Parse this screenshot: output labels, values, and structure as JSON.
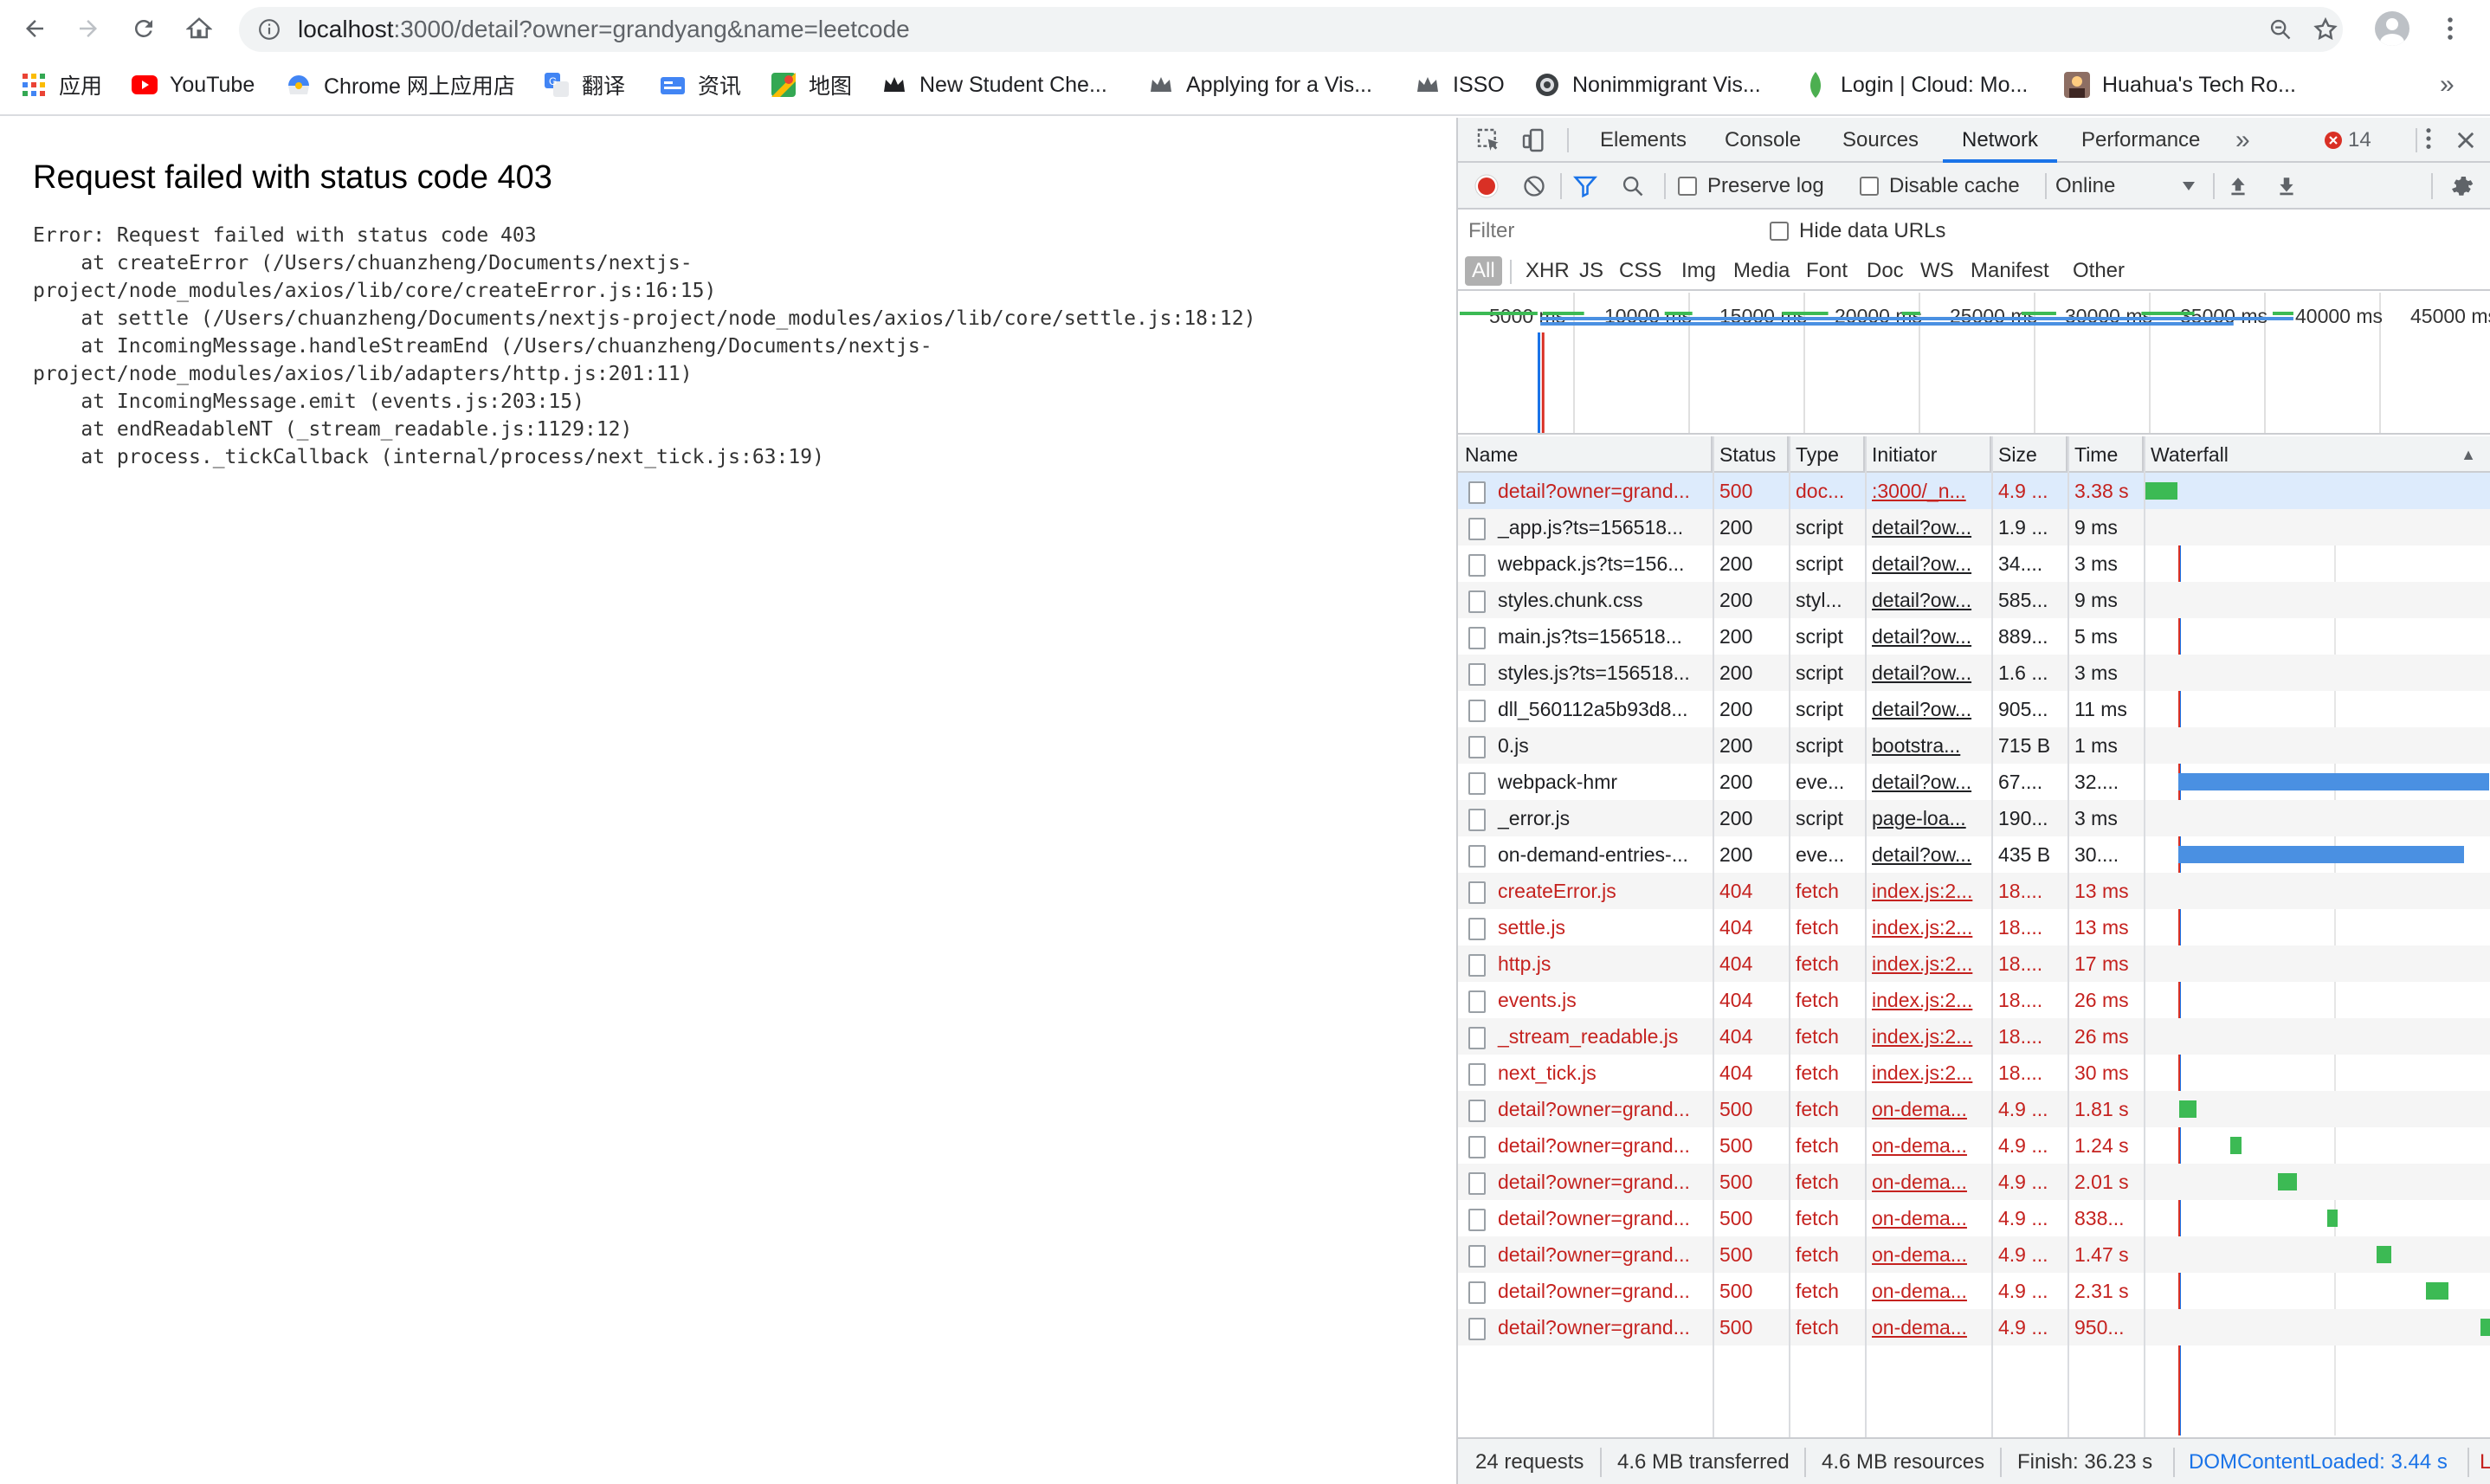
{
  "browser": {
    "url_host": "localhost",
    "url_rest": ":3000/detail?owner=grandyang&name=leetcode"
  },
  "bookmarks": [
    {
      "label": "应用",
      "icon": "apps-grid-icon"
    },
    {
      "label": "YouTube",
      "icon": "youtube-icon"
    },
    {
      "label": "Chrome 网上应用店",
      "icon": "chrome-webstore-icon"
    },
    {
      "label": "翻译",
      "icon": "translate-icon"
    },
    {
      "label": "资讯",
      "icon": "news-icon"
    },
    {
      "label": "地图",
      "icon": "maps-icon"
    },
    {
      "label": "New Student Che...",
      "icon": "crown-icon"
    },
    {
      "label": "Applying for a Vis...",
      "icon": "crown-icon"
    },
    {
      "label": "ISSO",
      "icon": "crown-icon"
    },
    {
      "label": "Nonimmigrant Vis...",
      "icon": "seal-icon"
    },
    {
      "label": "Login | Cloud: Mo...",
      "icon": "leaf-icon"
    },
    {
      "label": "Huahua's Tech Ro...",
      "icon": "avatar-icon"
    }
  ],
  "page": {
    "title": "Request failed with status code 403",
    "stack": "Error: Request failed with status code 403\n    at createError (/Users/chuanzheng/Documents/nextjs-\nproject/node_modules/axios/lib/core/createError.js:16:15)\n    at settle (/Users/chuanzheng/Documents/nextjs-project/node_modules/axios/lib/core/settle.js:18:12)\n    at IncomingMessage.handleStreamEnd (/Users/chuanzheng/Documents/nextjs-\nproject/node_modules/axios/lib/adapters/http.js:201:11)\n    at IncomingMessage.emit (events.js:203:15)\n    at endReadableNT (_stream_readable.js:1129:12)\n    at process._tickCallback (internal/process/next_tick.js:63:19)"
  },
  "devtools": {
    "tabs": [
      "Elements",
      "Console",
      "Sources",
      "Network",
      "Performance"
    ],
    "active_tab": "Network",
    "more_tabs": "»",
    "error_count": "14",
    "toolbar": {
      "preserve_log": "Preserve log",
      "disable_cache": "Disable cache",
      "throttle": "Online"
    },
    "filter_placeholder": "Filter",
    "hide_data_urls": "Hide data URLs",
    "types": [
      "All",
      "XHR",
      "JS",
      "CSS",
      "Img",
      "Media",
      "Font",
      "Doc",
      "WS",
      "Manifest",
      "Other"
    ],
    "overview_ticks": [
      "5000 ms",
      "10000 ms",
      "15000 ms",
      "20000 ms",
      "25000 ms",
      "30000 ms",
      "35000 ms",
      "40000 ms",
      "45000 ms"
    ],
    "columns": [
      "Name",
      "Status",
      "Type",
      "Initiator",
      "Size",
      "Time",
      "Waterfall"
    ],
    "sort_indicator": "▲",
    "rows": [
      {
        "name": "detail?owner=grand...",
        "status": "500",
        "type": "doc...",
        "initiator": ":3000/_n...",
        "size": "4.9 ...",
        "time": "3.38 s",
        "error": true,
        "wf_start": 0.0,
        "wf_end": 3.38,
        "wf_color": "#3cba54"
      },
      {
        "name": "_app.js?ts=156518...",
        "status": "200",
        "type": "script",
        "initiator": "detail?ow...",
        "size": "1.9 ...",
        "time": "9 ms",
        "error": false
      },
      {
        "name": "webpack.js?ts=156...",
        "status": "200",
        "type": "script",
        "initiator": "detail?ow...",
        "size": "34....",
        "time": "3 ms",
        "error": false
      },
      {
        "name": "styles.chunk.css",
        "status": "200",
        "type": "styl...",
        "initiator": "detail?ow...",
        "size": "585...",
        "time": "9 ms",
        "error": false
      },
      {
        "name": "main.js?ts=156518...",
        "status": "200",
        "type": "script",
        "initiator": "detail?ow...",
        "size": "889...",
        "time": "5 ms",
        "error": false
      },
      {
        "name": "styles.js?ts=156518...",
        "status": "200",
        "type": "script",
        "initiator": "detail?ow...",
        "size": "1.6 ...",
        "time": "3 ms",
        "error": false
      },
      {
        "name": "dll_560112a5b93d8...",
        "status": "200",
        "type": "script",
        "initiator": "detail?ow...",
        "size": "905...",
        "time": "11 ms",
        "error": false
      },
      {
        "name": "0.js",
        "status": "200",
        "type": "script",
        "initiator": "bootstra...",
        "size": "715 B",
        "time": "1 ms",
        "error": false
      },
      {
        "name": "webpack-hmr",
        "status": "200",
        "type": "eve...",
        "initiator": "detail?ow...",
        "size": "67....",
        "time": "32....",
        "error": false,
        "wf_start": 3.5,
        "wf_end": 36.2,
        "wf_color": "#4a90e2"
      },
      {
        "name": "_error.js",
        "status": "200",
        "type": "script",
        "initiator": "page-loa...",
        "size": "190...",
        "time": "3 ms",
        "error": false
      },
      {
        "name": "on-demand-entries-...",
        "status": "200",
        "type": "eve...",
        "initiator": "detail?ow...",
        "size": "435 B",
        "time": "30....",
        "error": false,
        "wf_start": 3.5,
        "wf_end": 33.6,
        "wf_color": "#4a90e2"
      },
      {
        "name": "createError.js",
        "status": "404",
        "type": "fetch",
        "initiator": "index.js:2...",
        "size": "18....",
        "time": "13 ms",
        "error": true
      },
      {
        "name": "settle.js",
        "status": "404",
        "type": "fetch",
        "initiator": "index.js:2...",
        "size": "18....",
        "time": "13 ms",
        "error": true
      },
      {
        "name": "http.js",
        "status": "404",
        "type": "fetch",
        "initiator": "index.js:2...",
        "size": "18....",
        "time": "17 ms",
        "error": true
      },
      {
        "name": "events.js",
        "status": "404",
        "type": "fetch",
        "initiator": "index.js:2...",
        "size": "18....",
        "time": "26 ms",
        "error": true
      },
      {
        "name": "_stream_readable.js",
        "status": "404",
        "type": "fetch",
        "initiator": "index.js:2...",
        "size": "18....",
        "time": "26 ms",
        "error": true
      },
      {
        "name": "next_tick.js",
        "status": "404",
        "type": "fetch",
        "initiator": "index.js:2...",
        "size": "18....",
        "time": "30 ms",
        "error": true
      },
      {
        "name": "detail?owner=grand...",
        "status": "500",
        "type": "fetch",
        "initiator": "on-dema...",
        "size": "4.9 ...",
        "time": "1.81 s",
        "error": true,
        "wf_start": 3.6,
        "wf_end": 5.4,
        "wf_color": "#3cba54"
      },
      {
        "name": "detail?owner=grand...",
        "status": "500",
        "type": "fetch",
        "initiator": "on-dema...",
        "size": "4.9 ...",
        "time": "1.24 s",
        "error": true,
        "wf_start": 8.9,
        "wf_end": 10.1,
        "wf_color": "#3cba54"
      },
      {
        "name": "detail?owner=grand...",
        "status": "500",
        "type": "fetch",
        "initiator": "on-dema...",
        "size": "4.9 ...",
        "time": "2.01 s",
        "error": true,
        "wf_start": 14.0,
        "wf_end": 16.0,
        "wf_color": "#3cba54"
      },
      {
        "name": "detail?owner=grand...",
        "status": "500",
        "type": "fetch",
        "initiator": "on-dema...",
        "size": "4.9 ...",
        "time": "838...",
        "error": true,
        "wf_start": 19.2,
        "wf_end": 20.0,
        "wf_color": "#3cba54"
      },
      {
        "name": "detail?owner=grand...",
        "status": "500",
        "type": "fetch",
        "initiator": "on-dema...",
        "size": "4.9 ...",
        "time": "1.47 s",
        "error": true,
        "wf_start": 24.4,
        "wf_end": 25.9,
        "wf_color": "#3cba54"
      },
      {
        "name": "detail?owner=grand...",
        "status": "500",
        "type": "fetch",
        "initiator": "on-dema...",
        "size": "4.9 ...",
        "time": "2.31 s",
        "error": true,
        "wf_start": 29.6,
        "wf_end": 31.9,
        "wf_color": "#3cba54"
      },
      {
        "name": "detail?owner=grand...",
        "status": "500",
        "type": "fetch",
        "initiator": "on-dema...",
        "size": "4.9 ...",
        "time": "950...",
        "error": true,
        "wf_start": 35.3,
        "wf_end": 36.2,
        "wf_color": "#3cba54"
      }
    ],
    "status_bar": {
      "requests": "24 requests",
      "transferred": "4.6 MB transferred",
      "resources": "4.6 MB resources",
      "finish": "Finish: 36.23 s",
      "dom_loaded": "DOMContentLoaded: 3.44 s",
      "load_cut": "L"
    },
    "colors": {
      "error_red": "#c5221f",
      "accent_blue": "#1a73e8",
      "waterfall_green": "#3cba54",
      "waterfall_blue": "#4a90e2",
      "dom_loaded_blue": "#1a73e8"
    }
  }
}
